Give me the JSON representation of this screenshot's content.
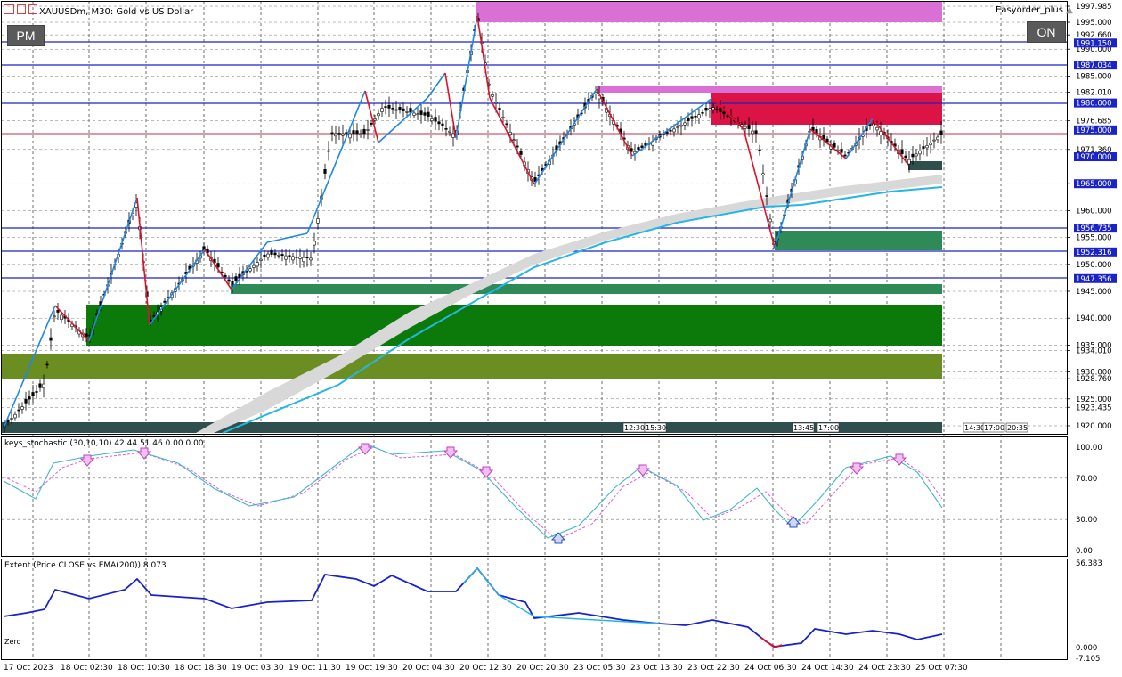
{
  "window": {
    "title": "XAUUSDm, M30:  Gold vs US Dollar",
    "expert_name": "Easyorder_plus"
  },
  "buttons": {
    "pm": "PM",
    "on": "ON"
  },
  "price_axis": {
    "labels": [
      "1997.985",
      "1995.000",
      "1992.660",
      "1990.000",
      "1985.000",
      "1982.010",
      "1976.685",
      "1971.360",
      "1965.000",
      "1960.000",
      "1955.000",
      "1950.000",
      "1945.000",
      "1940.000",
      "1935.000",
      "1934.010",
      "1930.000",
      "1928.760",
      "1925.000",
      "1923.435",
      "1920.000"
    ],
    "highlighted": [
      {
        "value": "1991.150",
        "color": "#1a23c8"
      },
      {
        "value": "1987.034",
        "color": "#1a23c8"
      },
      {
        "value": "1980.000",
        "color": "#1a23c8"
      },
      {
        "value": "1975.000",
        "color": "#1a23c8"
      },
      {
        "value": "1970.000",
        "color": "#1a23c8"
      },
      {
        "value": "1965.000",
        "color": "#1a23c8"
      },
      {
        "value": "1956.735",
        "color": "#1a23c8"
      },
      {
        "value": "1952.316",
        "color": "#1a23c8"
      },
      {
        "value": "1947.356",
        "color": "#1a23c8"
      }
    ]
  },
  "time_axis": [
    "17 Oct 2023",
    "18 Oct 02:30",
    "18 Oct 10:30",
    "18 Oct 18:30",
    "19 Oct 03:30",
    "19 Oct 11:30",
    "19 Oct 19:30",
    "20 Oct 04:30",
    "20 Oct 12:30",
    "20 Oct 20:30",
    "23 Oct 05:30",
    "23 Oct 13:30",
    "23 Oct 22:30",
    "24 Oct 06:30",
    "24 Oct 14:30",
    "24 Oct 23:30",
    "25 Oct 07:30"
  ],
  "bottom_time_tags": [
    "12:30",
    "15:30",
    "13:45",
    "17:00",
    "14:30",
    "17:00",
    "20:35"
  ],
  "indicators": {
    "stochastic": {
      "label": "keys_stochastic (30,10,10) 42.44 51.46 0.00 0.00",
      "axis": [
        "100.00",
        "70.00",
        "30.00",
        "0.00"
      ]
    },
    "extent": {
      "label": "Extent (Price CLOSE vs EMA(200)) 8.073",
      "axis": [
        "56.383",
        "0.000",
        "-7.105"
      ],
      "zero_label": "Zero"
    }
  },
  "colors": {
    "bull_zigzag": "#1e88e5",
    "bear_zigzag": "#e0102a",
    "level_line": "#1a23c8",
    "demand_zone": "#0b7a0b",
    "supply_zone": "#dc1445",
    "ema_line": "#25b6e6",
    "stoch_main": "#3fb8c8",
    "stoch_signal": "#e05ae0",
    "extent_line": "#1a23c8"
  }
}
